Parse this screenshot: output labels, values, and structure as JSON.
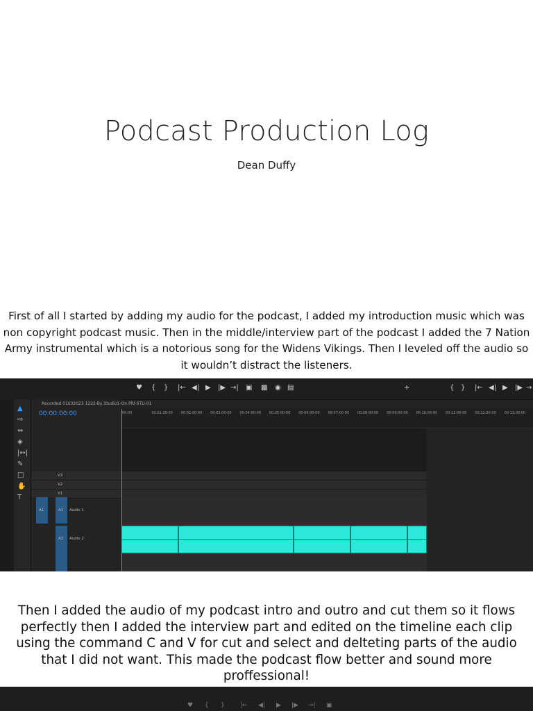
{
  "doc": {
    "title": "Podcast Production Log",
    "author": "Dean Duffy",
    "para1": "First of all I started by adding my audio for the podcast, I added my introduction music which was non copyright podcast music. Then in the middle/interview part of the podcast I added the 7 Nation Army instrumental which is a notorious song for the Widens Vikings. Then I leveled off the audio so it wouldn’t distract the listeners.",
    "para2": "Then I added the audio of my podcast intro and outro and cut them so it flows perfectly then I added the interview part and edited on the timeline each clip using the command C and V for cut and select and delteting parts of the audio that I did not want. This made the podcast flow better and sound more proffessional!"
  },
  "editor": {
    "sequence_name": "Recorded 01032023 1222-By Studio1-On PRI-STU-01",
    "timecode": "00:00:00:00",
    "ruler_ticks": [
      "00:00",
      "00:01:00:00",
      "00:02:00:00",
      "00:03:00:00",
      "00:04:00:00",
      "00:05:00:00",
      "00:06:00:00",
      "00:07:00:00",
      "00:08:00:00",
      "00:09:00:00",
      "00:10:00:00",
      "00:11:00:00",
      "00:12:00:00",
      "00:13:00:00"
    ],
    "tracks": {
      "v3": "V3",
      "v2": "V2",
      "v1": "V1",
      "a1": "A1",
      "a2": "A2",
      "audio1": "Audio 1",
      "audio2": "Audio 2"
    },
    "colors": {
      "clip": "#2be8d8",
      "playhead": "#3a9bff",
      "track_select": "#2a5a86"
    }
  }
}
